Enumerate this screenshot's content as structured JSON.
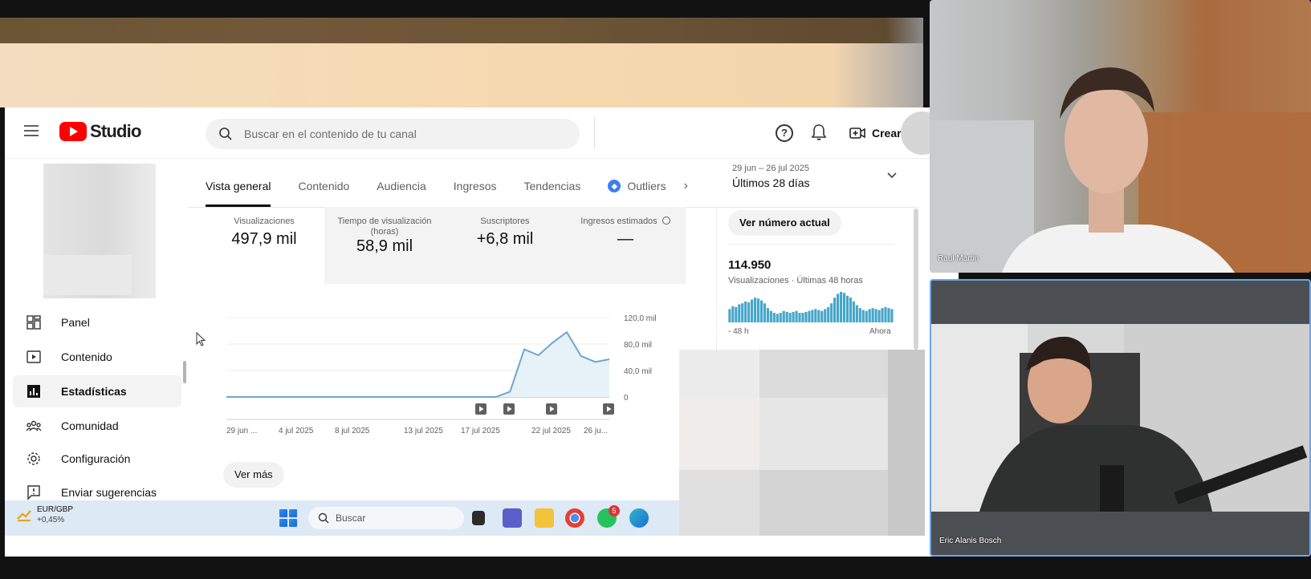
{
  "studio": {
    "logo_text": "Studio",
    "search_placeholder": "Buscar en el contenido de tu canal",
    "create_label": "Crear",
    "help_glyph": "?"
  },
  "sidebar": {
    "items": [
      {
        "label": "Panel",
        "icon": "dashboard-icon"
      },
      {
        "label": "Contenido",
        "icon": "content-icon"
      },
      {
        "label": "Estadísticas",
        "icon": "analytics-icon",
        "active": true
      },
      {
        "label": "Comunidad",
        "icon": "community-icon"
      },
      {
        "label": "Configuración",
        "icon": "gear-icon"
      },
      {
        "label": "Enviar sugerencias",
        "icon": "feedback-icon"
      }
    ]
  },
  "tabs": {
    "items": [
      "Vista general",
      "Contenido",
      "Audiencia",
      "Ingresos",
      "Tendencias"
    ],
    "outliers": "Outliers",
    "active": "Vista general"
  },
  "date_range": {
    "range": "29 jun – 26 jul 2025",
    "label": "Últimos 28 días"
  },
  "metrics": [
    {
      "label": "Visualizaciones",
      "value": "497,9 mil"
    },
    {
      "label": "Tiempo de visualización (horas)",
      "value": "58,9 mil"
    },
    {
      "label": "Suscriptores",
      "value": "+6,8 mil"
    },
    {
      "label": "Ingresos estimados",
      "value": "—"
    }
  ],
  "chart_data": {
    "type": "area",
    "y_ticks": [
      "120,0 mil",
      "80,0 mil",
      "40,0 mil",
      "0"
    ],
    "x_ticks": [
      "29 jun ...",
      "4 jul 2025",
      "8 jul 2025",
      "13 jul 2025",
      "17 jul 2025",
      "22 jul 2025",
      "26 ju..."
    ],
    "ylim": [
      0,
      120000
    ],
    "values": [
      0,
      0,
      0,
      0,
      0,
      0,
      0,
      0,
      0,
      0,
      0,
      0,
      0,
      0,
      0,
      0,
      0,
      0,
      0,
      0,
      8000,
      72000,
      63000,
      82000,
      98000,
      62000,
      53000,
      57000
    ],
    "color": "#6fa6c9"
  },
  "ver_mas": "Ver más",
  "realtime": {
    "button": "Ver número actual",
    "number": "114.950",
    "subtitle": "Visualizaciones · Últimas 48 horas",
    "left_label": "- 48 h",
    "right_label": "Ahora",
    "bars": [
      14,
      17,
      16,
      19,
      20,
      22,
      21,
      24,
      26,
      25,
      23,
      20,
      15,
      12,
      10,
      9,
      10,
      12,
      11,
      10,
      11,
      12,
      10,
      10,
      11,
      12,
      13,
      14,
      13,
      12,
      14,
      16,
      20,
      26,
      30,
      32,
      31,
      28,
      26,
      22,
      18,
      15,
      13,
      12,
      14,
      15,
      14,
      13,
      15,
      16,
      15,
      14
    ]
  },
  "taskbar": {
    "ticker": "EUR/GBP",
    "change": "+0,45%",
    "search": "Buscar",
    "whatsapp_badge": "5"
  },
  "cams": {
    "cam1_name": "Raul Martin",
    "cam2_name": "Eric Alanis Bosch"
  }
}
